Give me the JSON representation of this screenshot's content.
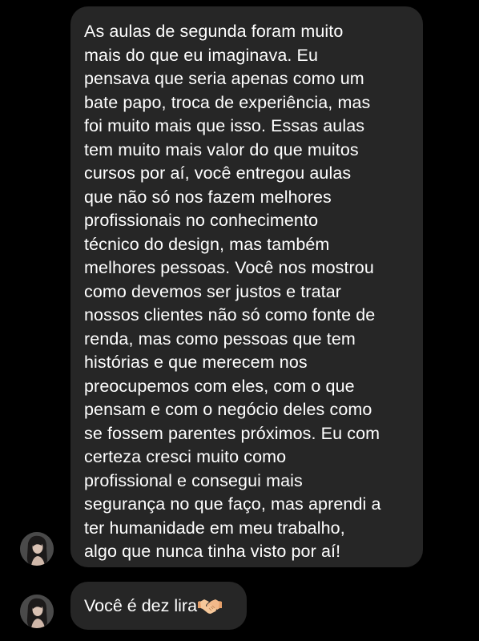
{
  "conversation": {
    "messages": [
      {
        "sender_avatar": "avatar-woman-photo",
        "lines": [
          "As aulas de segunda foram muito",
          "mais do que eu imaginava. Eu",
          "pensava que seria apenas como um",
          "bate papo, troca de experiência, mas",
          "foi muito mais que isso. Essas aulas",
          "tem muito mais valor do que muitos",
          "cursos por aí, você entregou aulas",
          "que não só nos fazem melhores",
          "profissionais no conhecimento",
          "técnico do design, mas também",
          "melhores pessoas. Você nos mostrou",
          "como devemos ser justos e tratar",
          "nossos clientes não só como fonte de",
          "renda, mas como pessoas que tem",
          "histórias e que merecem nos",
          "preocupemos com eles, com o que",
          "pensam e com o negócio deles como",
          "se fossem parentes próximos. Eu com",
          "certeza cresci muito como",
          "profissional e consegui mais",
          "segurança no que faço, mas aprendi a",
          "ter humanidade em meu trabalho,",
          "algo que nunca tinha visto por aí!"
        ]
      },
      {
        "sender_avatar": "avatar-woman-photo",
        "text": "Você é dez lira",
        "emoji": "handshake-emoji"
      }
    ]
  },
  "colors": {
    "background": "#000000",
    "bubble": "#262626",
    "text": "#ffffff"
  }
}
